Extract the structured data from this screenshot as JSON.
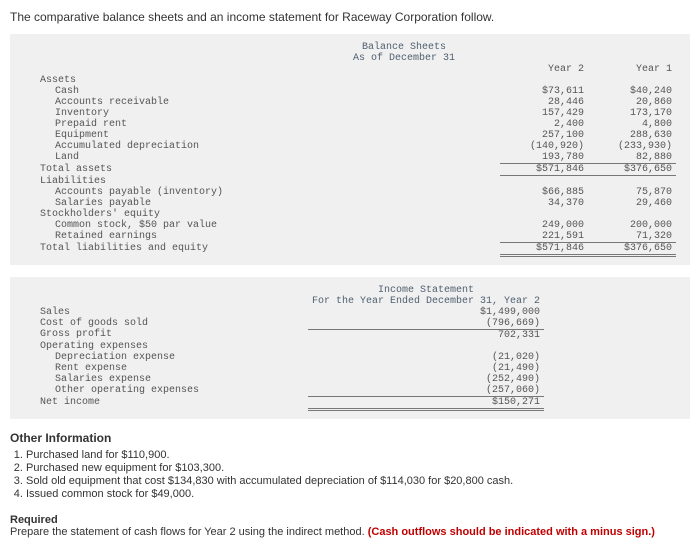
{
  "intro": "The comparative balance sheets and an income statement for Raceway Corporation follow.",
  "bs": {
    "title1": "Balance Sheets",
    "title2": "As of December 31",
    "col1": "Year 2",
    "col2": "Year 1",
    "assets_label": "Assets",
    "rows": [
      {
        "label": "Cash",
        "v1": "$73,611",
        "v2": "$40,240"
      },
      {
        "label": "Accounts receivable",
        "v1": "28,446",
        "v2": "20,860"
      },
      {
        "label": "Inventory",
        "v1": "157,429",
        "v2": "173,170"
      },
      {
        "label": "Prepaid rent",
        "v1": "2,400",
        "v2": "4,800"
      },
      {
        "label": "Equipment",
        "v1": "257,100",
        "v2": "288,630"
      },
      {
        "label": "Accumulated depreciation",
        "v1": "(140,920)",
        "v2": "(233,930)"
      },
      {
        "label": "Land",
        "v1": "193,780",
        "v2": "82,880"
      }
    ],
    "total_assets": {
      "label": "Total assets",
      "v1": "$571,846",
      "v2": "$376,650"
    },
    "liab_label": "Liabilities",
    "liab_rows": [
      {
        "label": "Accounts payable (inventory)",
        "v1": "$66,885",
        "v2": "75,870"
      },
      {
        "label": "Salaries payable",
        "v1": "34,370",
        "v2": "29,460"
      }
    ],
    "se_label": "Stockholders' equity",
    "se_rows": [
      {
        "label": "Common stock, $50 par value",
        "v1": "249,000",
        "v2": "200,000"
      },
      {
        "label": "Retained earnings",
        "v1": "221,591",
        "v2": "71,320"
      }
    ],
    "total_le": {
      "label": "Total liabilities and equity",
      "v1": "$571,846",
      "v2": "$376,650"
    }
  },
  "is": {
    "title1": "Income Statement",
    "title2": "For the Year Ended December 31, Year 2",
    "rows": [
      {
        "label": "Sales",
        "v": "$1,499,000",
        "ul": false
      },
      {
        "label": "Cost of goods sold",
        "v": "(796,669)",
        "ul": true
      },
      {
        "label": "Gross profit",
        "v": "702,331",
        "ul": false
      }
    ],
    "opex_label": "Operating expenses",
    "opex_rows": [
      {
        "label": "Depreciation expense",
        "v": "(21,020)"
      },
      {
        "label": "Rent expense",
        "v": "(21,490)"
      },
      {
        "label": "Salaries expense",
        "v": "(252,490)"
      },
      {
        "label": "Other operating expenses",
        "v": "(257,060)"
      }
    ],
    "net": {
      "label": "Net income",
      "v": "$150,271"
    }
  },
  "other_label": "Other Information",
  "other_items": [
    "Purchased land for $110,900.",
    "Purchased new equipment for $103,300.",
    "Sold old equipment that cost $134,830 with accumulated depreciation of $114,030 for $20,800 cash.",
    "Issued common stock for $49,000."
  ],
  "required_label": "Required",
  "required_text": "Prepare the statement of cash flows for Year 2 using the indirect method. ",
  "required_red": "(Cash outflows should be indicated with a minus sign.)"
}
